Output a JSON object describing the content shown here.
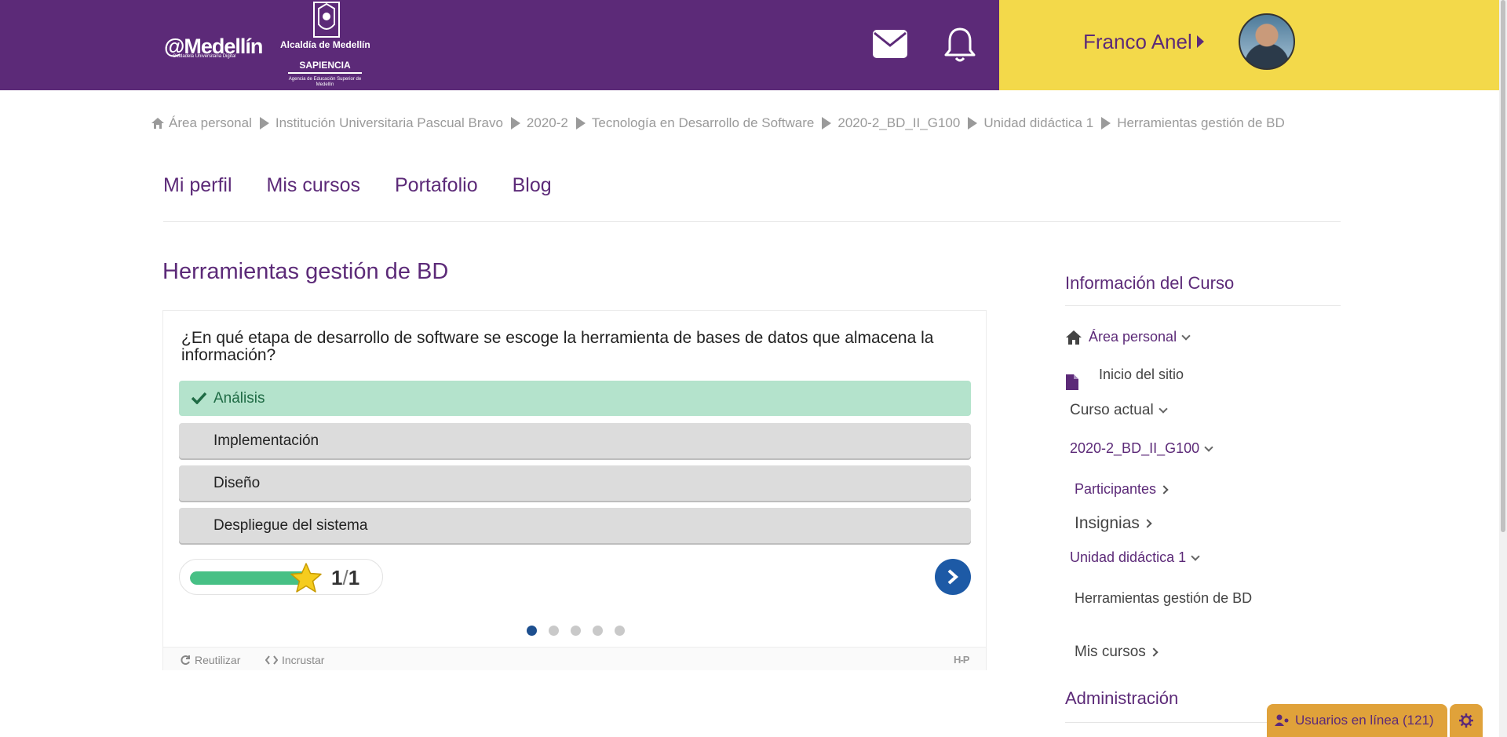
{
  "header": {
    "logo_medellin": "@Medellín",
    "logo_medellin_sub": "Ciudadela Universitaria Digital",
    "logo_alcaldia": "Alcaldía de Medellín",
    "logo_sapiencia": "SAPIENCIA",
    "logo_sapiencia_sub": "Agencia de Educación Superior de Medellín",
    "user_name": "Franco Anel",
    "colors": {
      "primary": "#5c2a78",
      "accent": "#f3d94a"
    },
    "icons": [
      "mail-icon",
      "bell-icon"
    ]
  },
  "breadcrumb": {
    "items": [
      "Área personal",
      "Institución Universitaria Pascual Bravo",
      "2020-2",
      "Tecnología en Desarrollo de Software",
      "2020-2_BD_II_G100",
      "Unidad didáctica 1",
      "Herramientas gestión de BD"
    ]
  },
  "nav": {
    "tabs": [
      "Mi perfil",
      "Mis cursos",
      "Portafolio",
      "Blog"
    ]
  },
  "page": {
    "title": "Herramientas gestión de BD"
  },
  "quiz": {
    "question": "¿En qué etapa de desarrollo de software se escoge la herramienta de bases de datos que almacena la información?",
    "answers": [
      {
        "label": "Análisis",
        "state": "correct"
      },
      {
        "label": "Implementación",
        "state": "none"
      },
      {
        "label": "Diseño",
        "state": "none"
      },
      {
        "label": "Despliegue del sistema",
        "state": "none"
      }
    ],
    "score": "1",
    "score_max": "1",
    "progress_fraction": 1.0,
    "slides_total": 5,
    "slide_current": 1,
    "footer": {
      "reuse": "Reutilizar",
      "embed": "Incrustar",
      "brand": "H-P"
    }
  },
  "sidebar": {
    "title": "Información del Curso",
    "area_personal": "Área personal",
    "inicio": "Inicio del sitio",
    "curso_actual": "Curso actual",
    "curso_code": "2020-2_BD_II_G100",
    "participantes": "Participantes",
    "insignias": "Insignias",
    "unidad": "Unidad didáctica 1",
    "herramientas": "Herramientas gestión de BD",
    "mis_cursos": "Mis cursos",
    "admin_title": "Administración"
  },
  "online": {
    "label": "Usuarios en línea (121)"
  }
}
